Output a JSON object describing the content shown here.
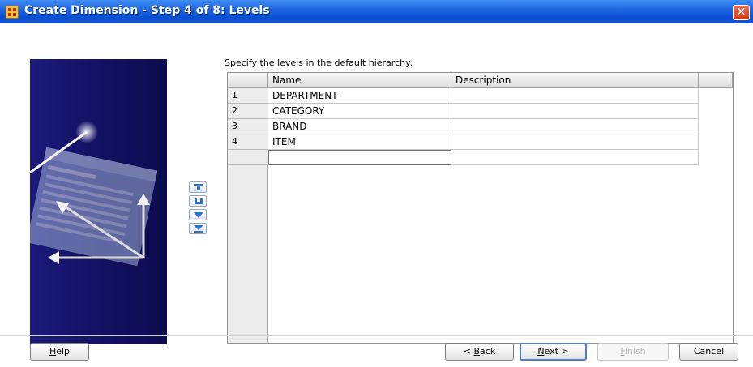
{
  "window": {
    "title": "Create Dimension - Step 4 of 8: Levels",
    "close_glyph": "✕"
  },
  "instruction": "Specify the levels in the default hierarchy:",
  "grid": {
    "columns": [
      "Name",
      "Description"
    ],
    "rows": [
      {
        "num": "1",
        "name": "DEPARTMENT",
        "description": ""
      },
      {
        "num": "2",
        "name": "CATEGORY",
        "description": ""
      },
      {
        "num": "3",
        "name": "BRAND",
        "description": ""
      },
      {
        "num": "4",
        "name": "ITEM",
        "description": ""
      },
      {
        "num": "",
        "name": "",
        "description": ""
      }
    ]
  },
  "reorder_buttons": [
    "move-to-top-icon",
    "move-up-icon",
    "move-down-icon",
    "move-to-bottom-icon"
  ],
  "buttons": {
    "help": {
      "mnemonic": "H",
      "rest": "elp"
    },
    "back": {
      "prefix": "< ",
      "mnemonic": "B",
      "rest": "ack"
    },
    "next": {
      "mnemonic": "N",
      "rest": "ext >"
    },
    "finish": {
      "mnemonic": "F",
      "rest": "inish"
    },
    "cancel": "Cancel"
  },
  "colors": {
    "titlebar": "#1c63e0",
    "side_panel": "#16156b",
    "default_button_border": "#4d7bd8"
  }
}
